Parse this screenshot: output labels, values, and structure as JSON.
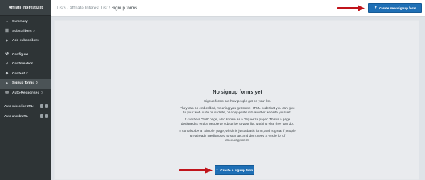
{
  "sidebar": {
    "title": "Affiliate Interest List",
    "items": [
      {
        "label": "Summary",
        "count": ""
      },
      {
        "label": "Subscribers",
        "count": "7"
      },
      {
        "label": "Add subscribers",
        "count": ""
      },
      {
        "label": "Configure",
        "count": ""
      },
      {
        "label": "Confirmation",
        "count": ""
      },
      {
        "label": "Content",
        "count": "0"
      },
      {
        "label": "Signup forms",
        "count": "0"
      },
      {
        "label": "Auto-Responses",
        "count": "0"
      }
    ],
    "auto_subscribe_label": "Auto subscribe URL:",
    "auto_unsub_label": "Auto unsub URL:"
  },
  "breadcrumb": {
    "lists": "Lists",
    "list_name": "Affiliate Interest List",
    "current": "Signup forms"
  },
  "header": {
    "create_button_label": "Create new signup form"
  },
  "empty_state": {
    "heading": "No signup forms yet",
    "paragraphs": [
      "Signup forms are how people get on your list.",
      "They can be embedded, meaning you get some HTML code that you can give to your web dude or dudette, or copy-paste into another website yourself.",
      "It can be a \"Full\" page, also known as a \"Squeeze page\". This is a page designed to entice people to subscribe to your list. Nothing else they can do.",
      "It can also be a \"Simple\" page, which is just a basic form, and is great if people are already predisposed to sign up, and don't need a whole lot of encouragement."
    ],
    "button_label": "Create a signup form"
  },
  "colors": {
    "primary_button": "#1e6fb5",
    "sidebar_bg": "#2e3436",
    "annotation_arrow": "#c0141b"
  }
}
